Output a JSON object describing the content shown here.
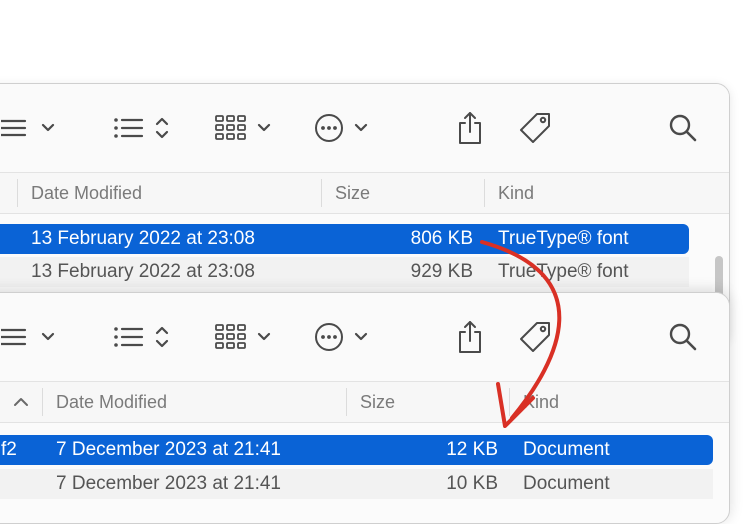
{
  "toolbar": {
    "icons": [
      "sidebar-list-icon",
      "chevron-down-icon",
      "list-view-icon",
      "sort-updown-icon",
      "grid-view-icon",
      "chevron-down-icon",
      "more-actions-icon",
      "chevron-down-icon",
      "share-icon",
      "tag-icon",
      "search-icon"
    ]
  },
  "window_top": {
    "headers": {
      "date": "Date Modified",
      "size": "Size",
      "kind": "Kind"
    },
    "rows": [
      {
        "date": "13 February 2022 at 23:08",
        "size": "806 KB",
        "kind": "TrueType® font",
        "selected": true
      },
      {
        "date": "13 February 2022 at 23:08",
        "size": "929 KB",
        "kind": "TrueType® font",
        "selected": false
      }
    ]
  },
  "window_bottom": {
    "headers": {
      "date": "Date Modified",
      "size": "Size",
      "kind": "Kind"
    },
    "rows": [
      {
        "name_tail": "f2",
        "date": "7 December 2023 at 21:41",
        "size": "12 KB",
        "kind": "Document",
        "selected": true
      },
      {
        "name_tail": "",
        "date": "7 December 2023 at 21:41",
        "size": "10 KB",
        "kind": "Document",
        "selected": false
      }
    ]
  },
  "colors": {
    "selection": "#0a63d6",
    "arrow": "#d93025"
  }
}
